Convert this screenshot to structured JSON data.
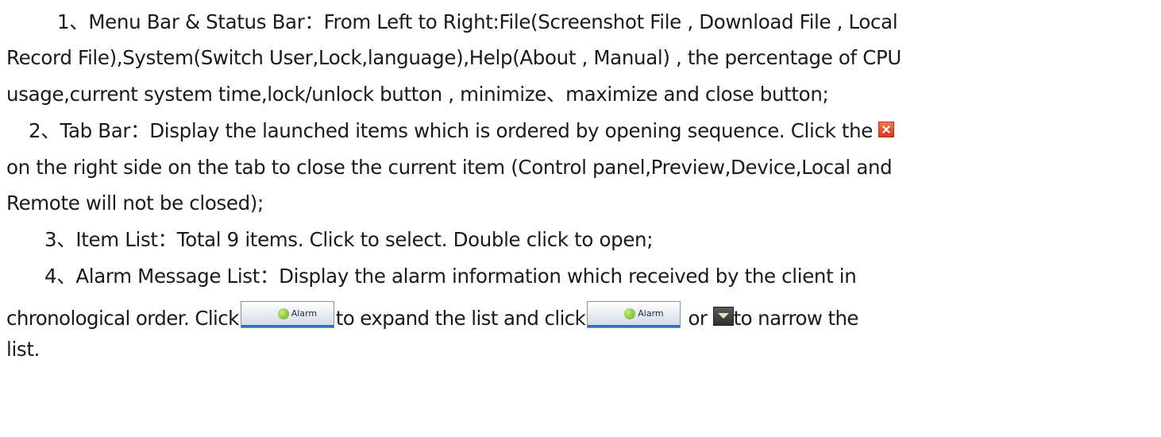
{
  "paragraphs": {
    "p1_l1": "1、Menu Bar & Status Bar：From Left to Right:File(Screenshot File , Download File , Local",
    "p1_l2": "Record File),System(Switch User,Lock,language),Help(About , Manual) , the percentage of CPU",
    "p1_l3": "usage,current system time,lock/unlock button , minimize、maximize and close button;",
    "p2_l1": "2、Tab Bar：Display the launched items which is ordered by opening sequence. Click the",
    "p2_l2": "on the right side on the tab to close the current item (Control panel,Preview,Device,Local and",
    "p2_l3": "Remote will not be closed);",
    "p3_l1": "3、Item List：Total 9 items. Click to select. Double click to open;",
    "p4_l1": "4、Alarm Message List：Display the alarm information which received by the client in",
    "p4_l2_a": "chronological order. Click",
    "p4_l2_b": "to expand the list and click",
    "p4_l2_c": "or",
    "p4_l2_d": "to narrow the",
    "p4_l3": "list."
  },
  "alarm_button": {
    "label": "Alarm"
  },
  "icons": {
    "close": "close-icon",
    "alarm": "alarm-icon",
    "collapse": "chevron-down-icon"
  }
}
